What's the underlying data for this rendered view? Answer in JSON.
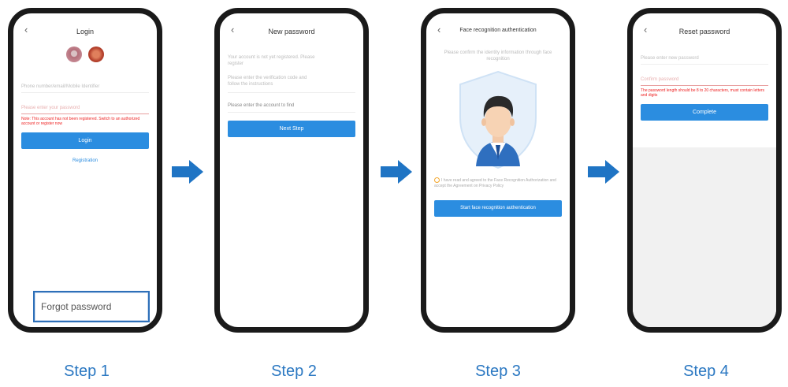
{
  "steps": [
    {
      "label": "Step 1"
    },
    {
      "label": "Step 2"
    },
    {
      "label": "Step 3"
    },
    {
      "label": "Step 4"
    }
  ],
  "phone1": {
    "title": "Login",
    "account_placeholder": "Phone number/email/Mobile Identifier",
    "password_placeholder": "Please enter your password",
    "error_text": "Note: This account has not been registered. Switch to an authorized account or register now",
    "login_button": "Login",
    "register_link": "Registration",
    "forgot_password": "Forgot password"
  },
  "phone2": {
    "title": "New password",
    "info_line1": "Your account is not yet registered. Please",
    "info_line2": "register",
    "hint_line1": "Please enter the verification code and",
    "hint_line2": "follow the instructions",
    "entry_label": "Please enter the account to find",
    "next_button": "Next Step"
  },
  "phone3": {
    "title": "Face recognition authentication",
    "intro": "Please confirm the identity information through face recognition",
    "consent": "I have read and agreed to the Face Recognition Authorization and accept the Agreement on Privacy Policy",
    "start_button": "Start face recognition authentication"
  },
  "phone4": {
    "title": "Reset password",
    "new_password_placeholder": "Please enter new password",
    "confirm_placeholder": "Confirm password",
    "error_text": "The password length should be 8 to 20 characters, must contain letters and digits",
    "complete_button": "Complete"
  },
  "colors": {
    "accent": "#2b8de0",
    "arrow": "#1f74c4",
    "step_text": "#2b78c2"
  },
  "icons": {
    "back": "chevron-left-icon",
    "arrow": "right-arrow-icon"
  }
}
